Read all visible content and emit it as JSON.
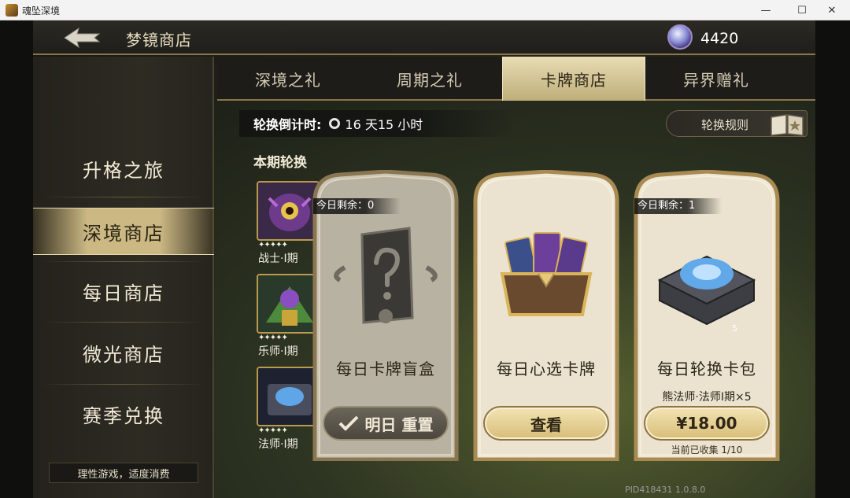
{
  "window": {
    "title": "魂坠深境",
    "min_glyph": "—",
    "max_glyph": "☐",
    "close_glyph": "✕"
  },
  "topbar": {
    "title": "梦镜商店",
    "currency_value": "4420"
  },
  "sidebar": {
    "items": [
      {
        "label": "升格之旅",
        "active": false
      },
      {
        "label": "深境商店",
        "active": true
      },
      {
        "label": "每日商店",
        "active": false
      },
      {
        "label": "微光商店",
        "active": false
      },
      {
        "label": "赛季兑换",
        "active": false
      }
    ],
    "notice": "理性游戏，适度消费"
  },
  "tabs": [
    {
      "label": "深境之礼",
      "active": false
    },
    {
      "label": "周期之礼",
      "active": false
    },
    {
      "label": "卡牌商店",
      "active": true
    },
    {
      "label": "异界赠礼",
      "active": false
    }
  ],
  "countdown": {
    "label": "轮换倒计时:",
    "time": "16 天15 小时"
  },
  "rules_button": {
    "label": "轮换规则"
  },
  "rotation": {
    "heading": "本期轮换",
    "items": [
      {
        "name": "战士·I期",
        "stars": "✦✦✦✦✦"
      },
      {
        "name": "乐师·I期",
        "stars": "✦✦✦✦✦"
      },
      {
        "name": "法师·I期",
        "stars": "✦✦✦✦✦"
      }
    ]
  },
  "cards": [
    {
      "remaining": "今日剩余：0",
      "name": "每日卡牌盲盒",
      "button": "明日 重置"
    },
    {
      "name": "每日心选卡牌",
      "button": "查看"
    },
    {
      "remaining": "今日剩余：1",
      "name": "每日轮换卡包",
      "subtitle": "熊法师·法师I期×5",
      "quantity": "5",
      "button": "¥18.00",
      "collected": "当前已收集 1/10"
    }
  ],
  "build": "PID418431 1.0.8.0",
  "colors": {
    "gold": "#cbb883",
    "frame": "#b7975a",
    "panel": "#ebe3cf"
  }
}
